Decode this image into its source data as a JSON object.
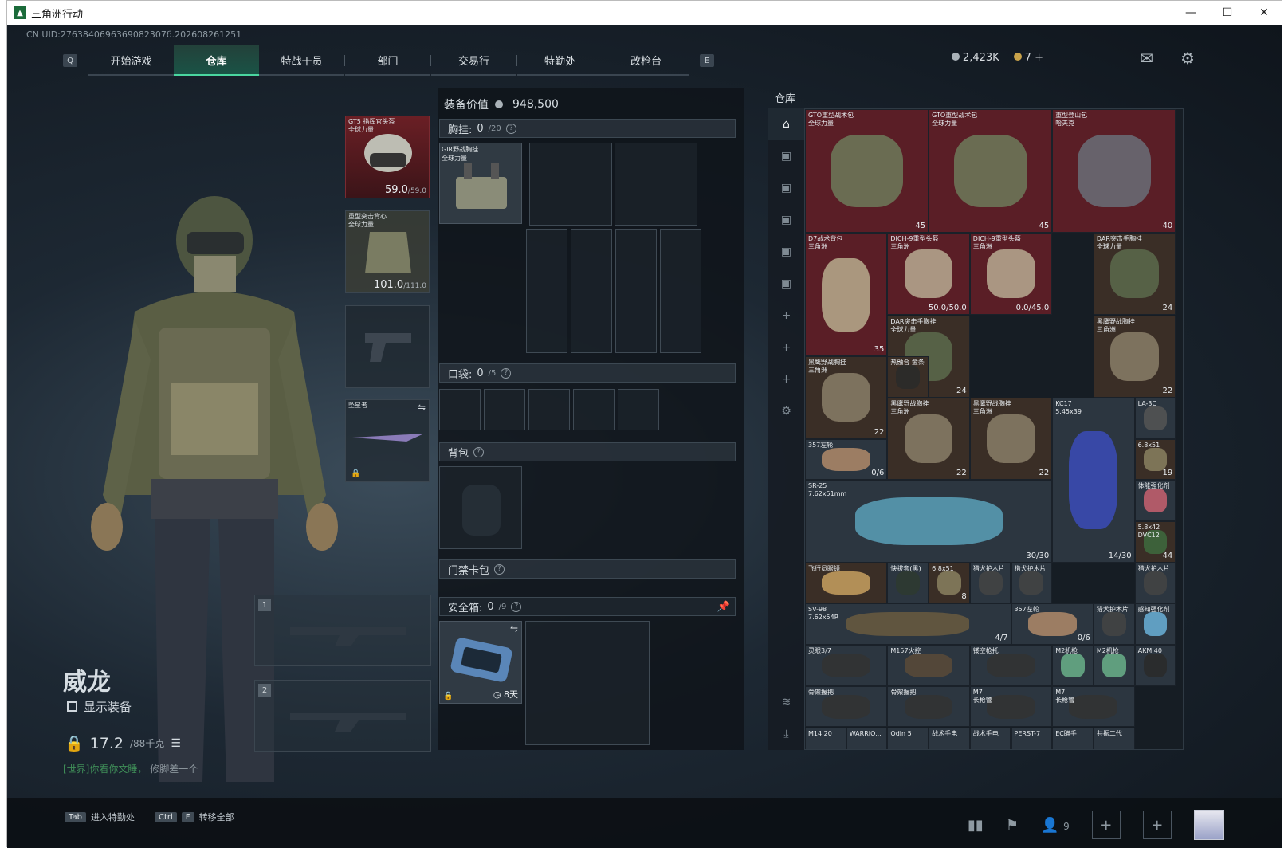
{
  "window": {
    "title": "三角洲行动",
    "min": "—",
    "max": "☐",
    "close": "✕"
  },
  "uid": "CN UID:2763840696369082307б.202608261251",
  "nav": {
    "left_key": "Q",
    "right_key": "E",
    "tabs": [
      "开始游戏",
      "仓库",
      "特战干员",
      "部门",
      "交易行",
      "特勤处",
      "改枪台"
    ]
  },
  "currency": {
    "money": "2,423K",
    "coins": "7",
    "plus": "+"
  },
  "operator": {
    "name": "威龙",
    "show_equipment": "显示装备",
    "weight": "17.2",
    "weight_max": "/88千克"
  },
  "chat": {
    "channel": "[世界]",
    "text": "你看你文睡，",
    "tail": "修脚差一个"
  },
  "gear": {
    "helmet": {
      "name": "GT5 指挥官头盔",
      "sub": "全球力量",
      "value": "59.0",
      "max": "/59.0"
    },
    "armor": {
      "name": "重型突击背心",
      "sub": "全球力量",
      "value": "101.0",
      "max": "/111.0"
    },
    "melee": {
      "name": "坠星者"
    },
    "slot1": "1",
    "slot2": "2"
  },
  "loadout": {
    "value_label": "装备价值",
    "value": "948,500",
    "chest_label": "胸挂:",
    "chest_count": "0",
    "chest_max": "/20",
    "chest_item": "GIR野战胸挂",
    "chest_item_sub": "全球力量",
    "pocket_label": "口袋:",
    "pocket_count": "0",
    "pocket_max": "/5",
    "backpack_label": "背包",
    "keycard_label": "门禁卡包",
    "safe_label": "安全箱:",
    "safe_count": "0",
    "safe_max": "/9",
    "safe_days": "8天"
  },
  "warehouse": {
    "label": "仓库",
    "sidebar": [
      "⌂",
      "▣",
      "▣",
      "▣",
      "▣",
      "▣",
      "+",
      "+",
      "+",
      "⚙",
      "≋",
      "⤓"
    ],
    "items": [
      {
        "name": "GTO重型战术包",
        "sub": "全球力量",
        "count": "45",
        "c": "r",
        "color": "#6d7a5a"
      },
      {
        "name": "GTO重型战术包",
        "sub": "全球力量",
        "count": "45",
        "c": "r",
        "color": "#6d7a5a"
      },
      {
        "name": "重型登山包",
        "sub": "哈夫克",
        "count": "40",
        "c": "r",
        "color": "#6a6e78"
      },
      {
        "name": "D7战术背包",
        "sub": "三角洲",
        "count": "35",
        "c": "r",
        "color": "#b8ad8e"
      },
      {
        "name": "DICH-9重型头盔",
        "sub": "三角洲",
        "count": "50.0/50.0",
        "c": "r",
        "color": "#b9ab93"
      },
      {
        "name": "DICH-9重型头盔",
        "sub": "三角洲",
        "count": "0.0/45.0",
        "c": "r",
        "color": "#b9ab93"
      },
      {
        "name": "DAR突击手胸挂",
        "sub": "全球力量",
        "count": "24",
        "c": "br",
        "color": "#5c6a4c"
      },
      {
        "name": "DAR突击手胸挂",
        "sub": "全球力量",
        "count": "24",
        "c": "br",
        "color": "#5c6a4c"
      },
      {
        "name": "DAR突击手胸挂",
        "sub": "全球力量",
        "count": "24",
        "c": "br",
        "color": "#5c6a4c"
      },
      {
        "name": "黑鹰野战胸挂",
        "sub": "三角洲",
        "count": "22",
        "c": "br",
        "color": "#8a7e68"
      },
      {
        "name": "黑鹰野战胸挂",
        "sub": "三角洲",
        "count": "22",
        "c": "br",
        "color": "#8a7e68"
      },
      {
        "name": "热融合 金条",
        "sub": "",
        "count": "",
        "c": "br",
        "color": "#2a2a2a"
      },
      {
        "name": "黑鹰野战胸挂",
        "sub": "三角洲",
        "count": "22",
        "c": "br",
        "color": "#8a7e68"
      },
      {
        "name": "黑鹰野战胸挂",
        "sub": "三角洲",
        "count": "22",
        "c": "br",
        "color": "#8a7e68"
      },
      {
        "name": "KC17",
        "sub": "5.45x39",
        "count": "14/30",
        "c": "g",
        "color": "#3b4bb8"
      },
      {
        "name": "LA-3C",
        "sub": "",
        "count": "",
        "c": "g",
        "color": "#555"
      },
      {
        "name": "357左轮",
        "sub": "",
        "count": "0/6",
        "c": "g",
        "color": "#b08a6a"
      },
      {
        "name": "6.8x51",
        "sub": "",
        "count": "19",
        "c": "br",
        "color": "#8a8060"
      },
      {
        "name": "SR-25",
        "sub": "7.62x51mm",
        "count": "30/30",
        "c": "g",
        "color": "#5aa0b8"
      },
      {
        "name": "体能强化剂",
        "sub": "",
        "count": "",
        "c": "g",
        "color": "#c86070"
      },
      {
        "name": "5.8x42",
        "sub": "DVC12",
        "count": "44",
        "c": "br",
        "color": "#3e6a3e"
      },
      {
        "name": "飞行员眼镜",
        "sub": "",
        "count": "",
        "c": "br",
        "color": "#c8a060"
      },
      {
        "name": "快拔套(黑)",
        "sub": "",
        "count": "",
        "c": "g",
        "color": "#2e3a30"
      },
      {
        "name": "6.8x51",
        "sub": "",
        "count": "8",
        "c": "br",
        "color": "#8a8060"
      },
      {
        "name": "猎犬护木片",
        "sub": "",
        "count": "",
        "c": "g",
        "color": "#444"
      },
      {
        "name": "猎犬护木片",
        "sub": "",
        "count": "",
        "c": "g",
        "color": "#444"
      },
      {
        "name": "猎犬护木片",
        "sub": "",
        "count": "",
        "c": "g",
        "color": "#444"
      },
      {
        "name": "SV-98",
        "sub": "7.62x54R",
        "count": "4/7",
        "c": "g",
        "color": "#6a5a40"
      },
      {
        "name": "357左轮",
        "sub": "",
        "count": "0/6",
        "c": "g",
        "color": "#b08a6a"
      },
      {
        "name": "猎犬护木片",
        "sub": "",
        "count": "",
        "c": "g",
        "color": "#444"
      },
      {
        "name": "感知强化剂",
        "sub": "",
        "count": "",
        "c": "g",
        "color": "#6ab0d8"
      },
      {
        "name": "灵眼3/7",
        "sub": "",
        "count": "",
        "c": "g",
        "color": "#333"
      },
      {
        "name": "M157火控",
        "sub": "",
        "count": "",
        "c": "g",
        "color": "#5a4a38"
      },
      {
        "name": "镂空枪托",
        "sub": "",
        "count": "",
        "c": "g",
        "color": "#333"
      },
      {
        "name": "M2机枪",
        "sub": "",
        "count": "",
        "c": "g",
        "color": "#6ab08a"
      },
      {
        "name": "M2机枪",
        "sub": "",
        "count": "",
        "c": "g",
        "color": "#6ab08a"
      },
      {
        "name": "AKM 40",
        "sub": "",
        "count": "",
        "c": "g",
        "color": "#2a2a2a"
      },
      {
        "name": "骨架握把",
        "sub": "",
        "count": "",
        "c": "g",
        "color": "#333"
      },
      {
        "name": "骨架握把",
        "sub": "",
        "count": "",
        "c": "g",
        "color": "#333"
      },
      {
        "name": "M7",
        "sub": "长枪管",
        "count": "",
        "c": "g",
        "color": "#333"
      },
      {
        "name": "M7",
        "sub": "长枪管",
        "count": "",
        "c": "g",
        "color": "#333"
      }
    ],
    "bottom_row": [
      "M14 20",
      "WARRIO...",
      "Odin 5",
      "战术手电",
      "战术手电",
      "PERST-7",
      "EC瞄手",
      "共振二代"
    ]
  },
  "bottom": {
    "tab_key": "Tab",
    "tab_label": "进入特勤处",
    "ctrl_key": "Ctrl",
    "f_key": "F",
    "ctrl_label": "转移全部",
    "friends": "9"
  }
}
